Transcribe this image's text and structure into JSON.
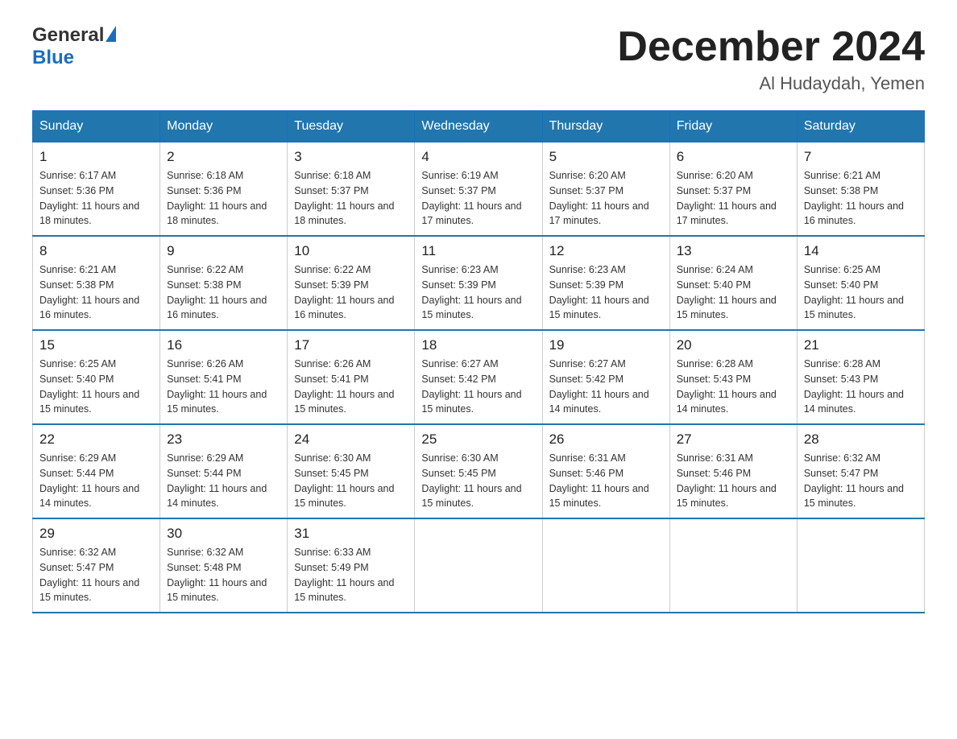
{
  "logo": {
    "line1": "General",
    "line2": "Blue"
  },
  "title": "December 2024",
  "location": "Al Hudaydah, Yemen",
  "days_of_week": [
    "Sunday",
    "Monday",
    "Tuesday",
    "Wednesday",
    "Thursday",
    "Friday",
    "Saturday"
  ],
  "weeks": [
    [
      {
        "day": "1",
        "sunrise": "6:17 AM",
        "sunset": "5:36 PM",
        "daylight": "11 hours and 18 minutes."
      },
      {
        "day": "2",
        "sunrise": "6:18 AM",
        "sunset": "5:36 PM",
        "daylight": "11 hours and 18 minutes."
      },
      {
        "day": "3",
        "sunrise": "6:18 AM",
        "sunset": "5:37 PM",
        "daylight": "11 hours and 18 minutes."
      },
      {
        "day": "4",
        "sunrise": "6:19 AM",
        "sunset": "5:37 PM",
        "daylight": "11 hours and 17 minutes."
      },
      {
        "day": "5",
        "sunrise": "6:20 AM",
        "sunset": "5:37 PM",
        "daylight": "11 hours and 17 minutes."
      },
      {
        "day": "6",
        "sunrise": "6:20 AM",
        "sunset": "5:37 PM",
        "daylight": "11 hours and 17 minutes."
      },
      {
        "day": "7",
        "sunrise": "6:21 AM",
        "sunset": "5:38 PM",
        "daylight": "11 hours and 16 minutes."
      }
    ],
    [
      {
        "day": "8",
        "sunrise": "6:21 AM",
        "sunset": "5:38 PM",
        "daylight": "11 hours and 16 minutes."
      },
      {
        "day": "9",
        "sunrise": "6:22 AM",
        "sunset": "5:38 PM",
        "daylight": "11 hours and 16 minutes."
      },
      {
        "day": "10",
        "sunrise": "6:22 AM",
        "sunset": "5:39 PM",
        "daylight": "11 hours and 16 minutes."
      },
      {
        "day": "11",
        "sunrise": "6:23 AM",
        "sunset": "5:39 PM",
        "daylight": "11 hours and 15 minutes."
      },
      {
        "day": "12",
        "sunrise": "6:23 AM",
        "sunset": "5:39 PM",
        "daylight": "11 hours and 15 minutes."
      },
      {
        "day": "13",
        "sunrise": "6:24 AM",
        "sunset": "5:40 PM",
        "daylight": "11 hours and 15 minutes."
      },
      {
        "day": "14",
        "sunrise": "6:25 AM",
        "sunset": "5:40 PM",
        "daylight": "11 hours and 15 minutes."
      }
    ],
    [
      {
        "day": "15",
        "sunrise": "6:25 AM",
        "sunset": "5:40 PM",
        "daylight": "11 hours and 15 minutes."
      },
      {
        "day": "16",
        "sunrise": "6:26 AM",
        "sunset": "5:41 PM",
        "daylight": "11 hours and 15 minutes."
      },
      {
        "day": "17",
        "sunrise": "6:26 AM",
        "sunset": "5:41 PM",
        "daylight": "11 hours and 15 minutes."
      },
      {
        "day": "18",
        "sunrise": "6:27 AM",
        "sunset": "5:42 PM",
        "daylight": "11 hours and 15 minutes."
      },
      {
        "day": "19",
        "sunrise": "6:27 AM",
        "sunset": "5:42 PM",
        "daylight": "11 hours and 14 minutes."
      },
      {
        "day": "20",
        "sunrise": "6:28 AM",
        "sunset": "5:43 PM",
        "daylight": "11 hours and 14 minutes."
      },
      {
        "day": "21",
        "sunrise": "6:28 AM",
        "sunset": "5:43 PM",
        "daylight": "11 hours and 14 minutes."
      }
    ],
    [
      {
        "day": "22",
        "sunrise": "6:29 AM",
        "sunset": "5:44 PM",
        "daylight": "11 hours and 14 minutes."
      },
      {
        "day": "23",
        "sunrise": "6:29 AM",
        "sunset": "5:44 PM",
        "daylight": "11 hours and 14 minutes."
      },
      {
        "day": "24",
        "sunrise": "6:30 AM",
        "sunset": "5:45 PM",
        "daylight": "11 hours and 15 minutes."
      },
      {
        "day": "25",
        "sunrise": "6:30 AM",
        "sunset": "5:45 PM",
        "daylight": "11 hours and 15 minutes."
      },
      {
        "day": "26",
        "sunrise": "6:31 AM",
        "sunset": "5:46 PM",
        "daylight": "11 hours and 15 minutes."
      },
      {
        "day": "27",
        "sunrise": "6:31 AM",
        "sunset": "5:46 PM",
        "daylight": "11 hours and 15 minutes."
      },
      {
        "day": "28",
        "sunrise": "6:32 AM",
        "sunset": "5:47 PM",
        "daylight": "11 hours and 15 minutes."
      }
    ],
    [
      {
        "day": "29",
        "sunrise": "6:32 AM",
        "sunset": "5:47 PM",
        "daylight": "11 hours and 15 minutes."
      },
      {
        "day": "30",
        "sunrise": "6:32 AM",
        "sunset": "5:48 PM",
        "daylight": "11 hours and 15 minutes."
      },
      {
        "day": "31",
        "sunrise": "6:33 AM",
        "sunset": "5:49 PM",
        "daylight": "11 hours and 15 minutes."
      },
      null,
      null,
      null,
      null
    ]
  ]
}
